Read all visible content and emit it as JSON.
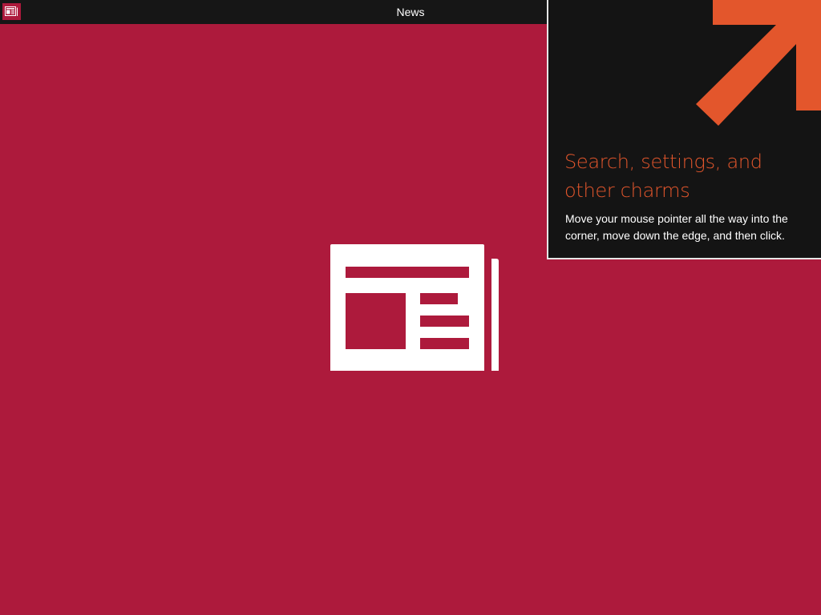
{
  "window": {
    "title": "News",
    "app_icon": "news-icon"
  },
  "splash": {
    "logo_icon": "newspaper-icon",
    "background": "#ad1a3c"
  },
  "tip": {
    "heading": "Search, settings, and other charms",
    "body": "Move your mouse pointer all the way into the corner, move down the edge, and then click.",
    "arrow_icon": "arrow-up-right-icon",
    "accent": "#e3562c"
  },
  "colors": {
    "titlebar": "#161616",
    "brand": "#ad1a3c",
    "tip_panel": "#141414",
    "tip_border": "#e6e6e6"
  }
}
